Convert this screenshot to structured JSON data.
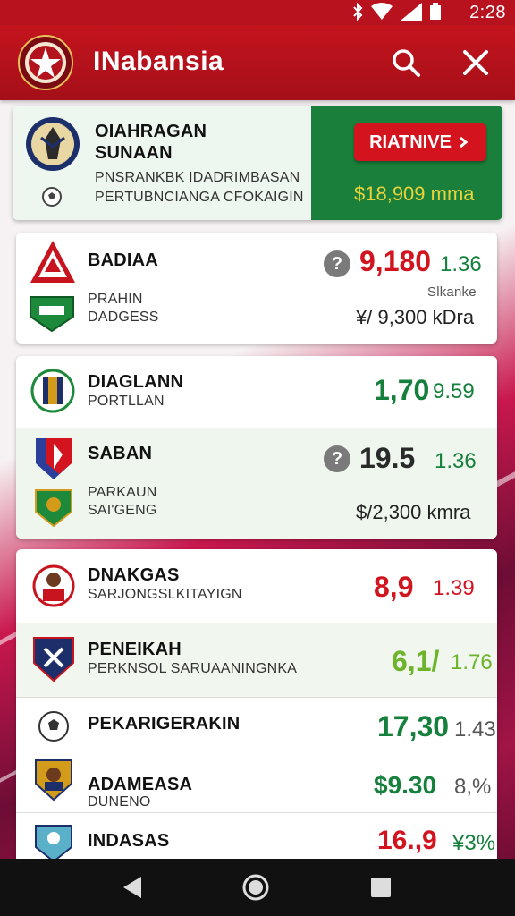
{
  "statusbar": {
    "time": "2:28"
  },
  "app": {
    "title": "INabansia"
  },
  "colors": {
    "brand_red": "#c4141e",
    "accent_green": "#1a7f3a",
    "odd_red": "#d2141f",
    "odd_green": "#15803c"
  },
  "icons": {
    "search": "search-icon",
    "close": "close-icon",
    "help": "question-icon",
    "back": "back-icon",
    "home": "home-icon",
    "recents": "recents-icon"
  },
  "featured": {
    "team_line1": "OIAHRAGAN",
    "team_line2": "SUNAAN",
    "desc_line1": "PNSRANKBK IDADRIMBASAN",
    "desc_line2": "PERTUBNCIANGA CFOKAIGIN",
    "button_label": "RIATNIVE",
    "prize": "$18,909 mma"
  },
  "match1": {
    "team1": "BADIAA",
    "team2": "PRAHIN",
    "team2_sub": "DADGESS",
    "odd_big": "9,180",
    "odd_small": "1.36",
    "label": "Slkanke",
    "amount": "¥/ 9,300 kDra"
  },
  "match2": {
    "team1": "DIAGLANN",
    "team1_sub": "PORTLLAN",
    "odd1_big": "1,70",
    "odd1_small": "9.59",
    "team2": "SABAN",
    "odd2_big": "19.5",
    "odd2_small": "1.36",
    "team3": "PARKAUN",
    "team3_sub": "SAI'GENG",
    "amount": "$/2,300 kmra"
  },
  "list": [
    {
      "team": "DNAKGAS",
      "sub": "SARJONGSLKITAYIGN",
      "odd_big": "8,9",
      "odd_small": "1.39"
    },
    {
      "team": "PENEIKAH",
      "sub": "PERKNSOL SARUAANINGNKA",
      "odd_big": "6,1/",
      "odd_small": "1.76"
    },
    {
      "team": "PEKARIGERAKIN",
      "sub": "",
      "odd_big": "17,30",
      "odd_small": "1.43"
    },
    {
      "team": "ADAMEASA",
      "sub": "DUNENO",
      "odd_big": "$9.30",
      "odd_small": "8,%"
    },
    {
      "team": "INDASAS",
      "sub": "",
      "odd_big": "16.,9",
      "odd_small": "¥3%"
    }
  ]
}
